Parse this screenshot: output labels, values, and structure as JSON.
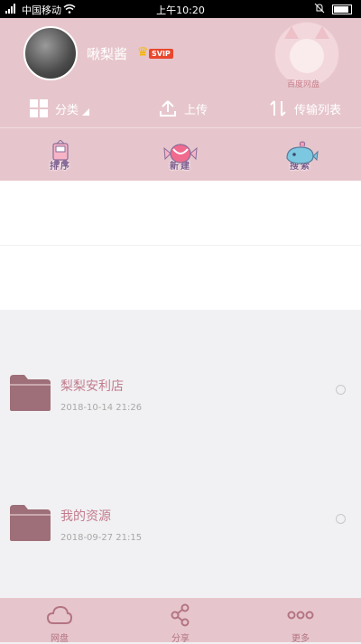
{
  "status_bar": {
    "signal": "4G",
    "carrier": "中国移动",
    "time": "上午10:20"
  },
  "profile": {
    "username": "啾梨酱",
    "badge": "SVIP",
    "mascot_label": "百度网盘"
  },
  "toolbar": {
    "category_label": "分类",
    "upload_label": "上传",
    "transfer_label": "传输列表"
  },
  "actions": [
    {
      "label": "排序",
      "icon": "sort-truck-icon"
    },
    {
      "label": "新建",
      "icon": "new-candy-icon"
    },
    {
      "label": "搜索",
      "icon": "search-whale-icon"
    }
  ],
  "files": [
    {
      "name": "梨梨安利店",
      "date": "2018-10-14  21:26",
      "icon": "folder-icon"
    },
    {
      "name": "我的资源",
      "date": "2018-09-27  21:15",
      "icon": "folder-icon"
    }
  ],
  "tabs": [
    {
      "label": "网盘",
      "icon": "cloud-icon"
    },
    {
      "label": "分享",
      "icon": "share-icon"
    },
    {
      "label": "更多",
      "icon": "more-icon"
    }
  ],
  "colors": {
    "header_bg": "#e6c6cc",
    "accent": "#c27c8e",
    "folder": "#9e6f78",
    "tab_icon": "#b47482"
  }
}
